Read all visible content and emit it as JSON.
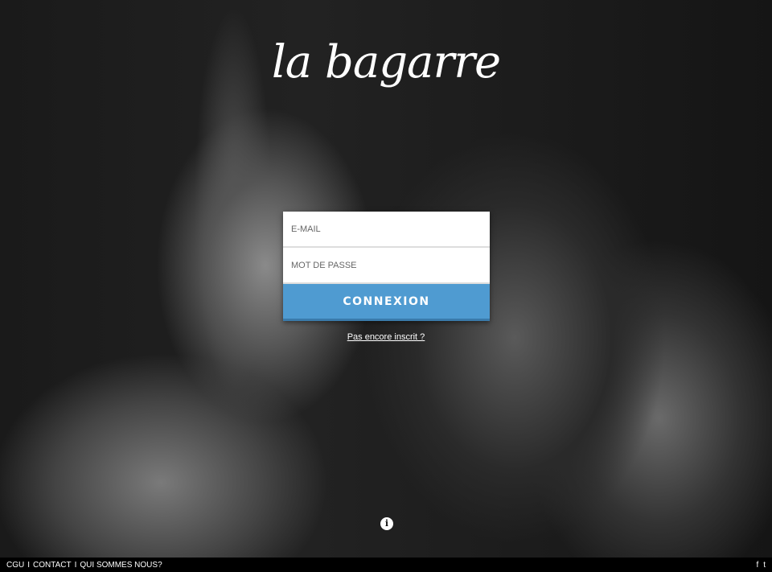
{
  "logo": "la bagarre",
  "form": {
    "email_placeholder": "E-MAIL",
    "password_placeholder": "MOT DE PASSE",
    "submit_label": "CONNEXION",
    "signup_link": "Pas encore inscrit ?"
  },
  "info_icon": "i",
  "footer": {
    "links": [
      "CGU",
      "CONTACT",
      "QUI SOMMES NOUS?"
    ],
    "separator": "I",
    "facebook": "f",
    "twitter": "t"
  },
  "colors": {
    "accent": "#4f9bd1"
  }
}
